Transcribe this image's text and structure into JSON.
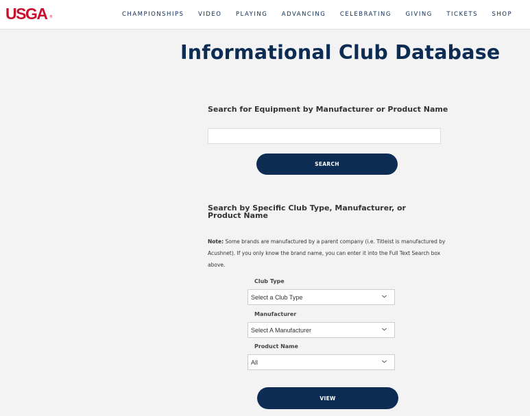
{
  "header": {
    "logo": "USGA",
    "logo_mark": "®",
    "nav": [
      "CHAMPIONSHIPS",
      "VIDEO",
      "PLAYING",
      "ADVANCING",
      "CELEBRATING",
      "GIVING",
      "TICKETS",
      "SHOP"
    ]
  },
  "page": {
    "title": "Informational Club Database"
  },
  "full_text_search": {
    "heading": "Search for Equipment by Manufacturer or Product Name",
    "value": "",
    "placeholder": "",
    "button_label": "SEARCH"
  },
  "specific_search": {
    "heading": "Search by Specific Club Type, Manufacturer, or Product Name",
    "note_label": "Note:",
    "note_text": " Some brands are manufactured by a parent company (i.e. Titleist is manufactured by Acushnet). If you only know the brand name, you can enter it into the Full Text Search box above.",
    "club_type": {
      "label": "Club Type",
      "selected": "Select a Club Type"
    },
    "manufacturer": {
      "label": "Manufacturer",
      "selected": "Select A Manufacturer"
    },
    "product_name": {
      "label": "Product Name",
      "selected": "All"
    },
    "button_label": "VIEW"
  },
  "colors": {
    "brand_navy": "#0c2c53",
    "brand_red": "#c8102e",
    "page_bg": "#f3f3f3"
  },
  "icons": {
    "dropdown": "chevron-down-icon"
  }
}
